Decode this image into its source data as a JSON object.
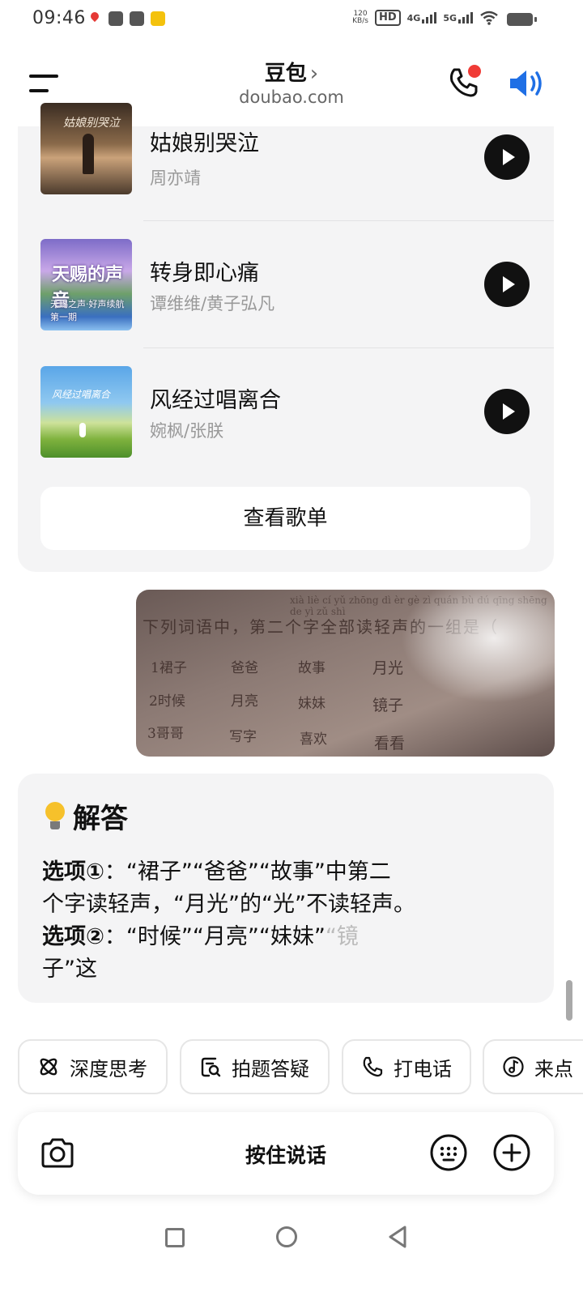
{
  "status_bar": {
    "time": "09:46",
    "speed_value": "120",
    "speed_unit": "KB/s",
    "hd_label": "HD",
    "net1": "4G",
    "net2": "5G"
  },
  "header": {
    "title": "豆包",
    "chevron": "›",
    "subtitle": "doubao.com"
  },
  "songs": [
    {
      "title": "姑娘别哭泣",
      "artist": "周亦靖",
      "cover_text": "姑娘别哭泣"
    },
    {
      "title": "转身即心痛",
      "artist": "谭维维/黄子弘凡",
      "cover_text": "天赐的声音",
      "cover_sub": "天赐之声·好声续航 第一期"
    },
    {
      "title": "风经过唱离合",
      "artist": "婉枫/张朕",
      "cover_text": "风经过唱离合"
    }
  ],
  "playlist_button": "查看歌单",
  "photo": {
    "pinyin": "xià liè cí yǔ zhōng dì èr gè zì quán bù dú qīng shēng de yì zǔ shì",
    "question": "下列词语中，第二个字全部读轻声的一组是（",
    "row1": [
      "1裙子",
      "爸爸",
      "故事",
      "月光"
    ],
    "row2": [
      "2时候",
      "月亮",
      "妹妹",
      "镜子"
    ],
    "row3": [
      "3哥哥",
      "写字",
      "喜欢",
      "看看"
    ]
  },
  "answer": {
    "heading": "解答",
    "line1_bold": "选项①",
    "line1_text": "：“裙子”“爸爸”“故事”中第二",
    "line2_text": "个字读轻声，“月光”的“光”不读轻声。",
    "line3_bold": "选项②",
    "line3_text": "：“时候”“月亮”“妹妹”",
    "line3_fade": "“镜",
    "line4_fade": "子”这"
  },
  "chips": [
    {
      "label": "深度思考",
      "icon": "atom-icon"
    },
    {
      "label": "拍题答疑",
      "icon": "scan-question-icon"
    },
    {
      "label": "打电话",
      "icon": "phone-icon"
    },
    {
      "label": "来点",
      "icon": "music-note-icon"
    }
  ],
  "input_bar": {
    "hold_to_talk": "按住说话"
  },
  "colors": {
    "accent_blue": "#1f6fe5",
    "notification_red": "#f03b36",
    "card_bg": "#f4f4f5"
  }
}
